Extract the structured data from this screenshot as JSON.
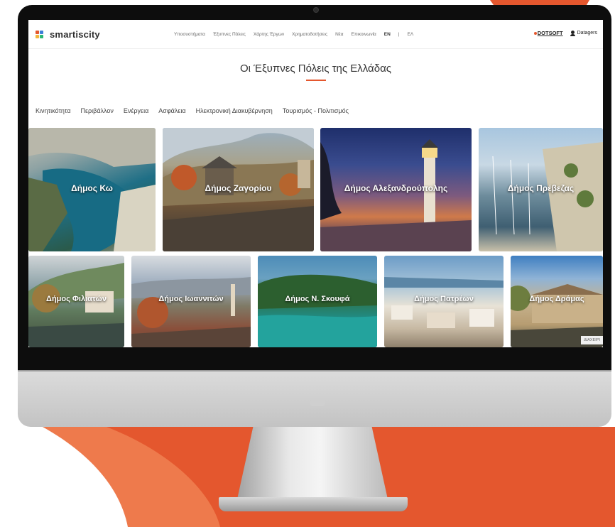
{
  "header": {
    "logo_text": "smartiscity",
    "nav": [
      "Υποσυστήματα",
      "Έξυπνες Πόλεις",
      "Χάρτης Έργων",
      "Χρηματοδοτήσεις",
      "Νέα",
      "Επικοινωνία"
    ],
    "lang_en": "EN",
    "lang_sep": "|",
    "lang_el": "ΕΛ",
    "dotsoft": "DOTSOFT",
    "user": "Datagers"
  },
  "page": {
    "title": "Οι Έξυπνες Πόλεις της Ελλάδας"
  },
  "tabs": [
    "Κινητικότητα",
    "Περιβάλλον",
    "Ενέργεια",
    "Ασφάλεια",
    "Ηλεκτρονική Διακυβέρνηση",
    "Τουρισμός - Πολιτισμός"
  ],
  "cities_row1": [
    "Δήμος Κω",
    "Δήμος Ζαγορίου",
    "Δήμος Αλεξανδρούπολης",
    "Δήμος Πρέβεζας"
  ],
  "cities_row2": [
    "Δήμος Φιλιατών",
    "Δήμος Ιωαννιτών",
    "Δήμος Ν. Σκουφά",
    "Δήμος Πατρέων",
    "Δήμος Δράμας"
  ],
  "manage_tag": "ΔΙΑΧΕΙΡΙ",
  "colors": {
    "accent": "#e4572e",
    "bezel": "#0d0d0d"
  }
}
